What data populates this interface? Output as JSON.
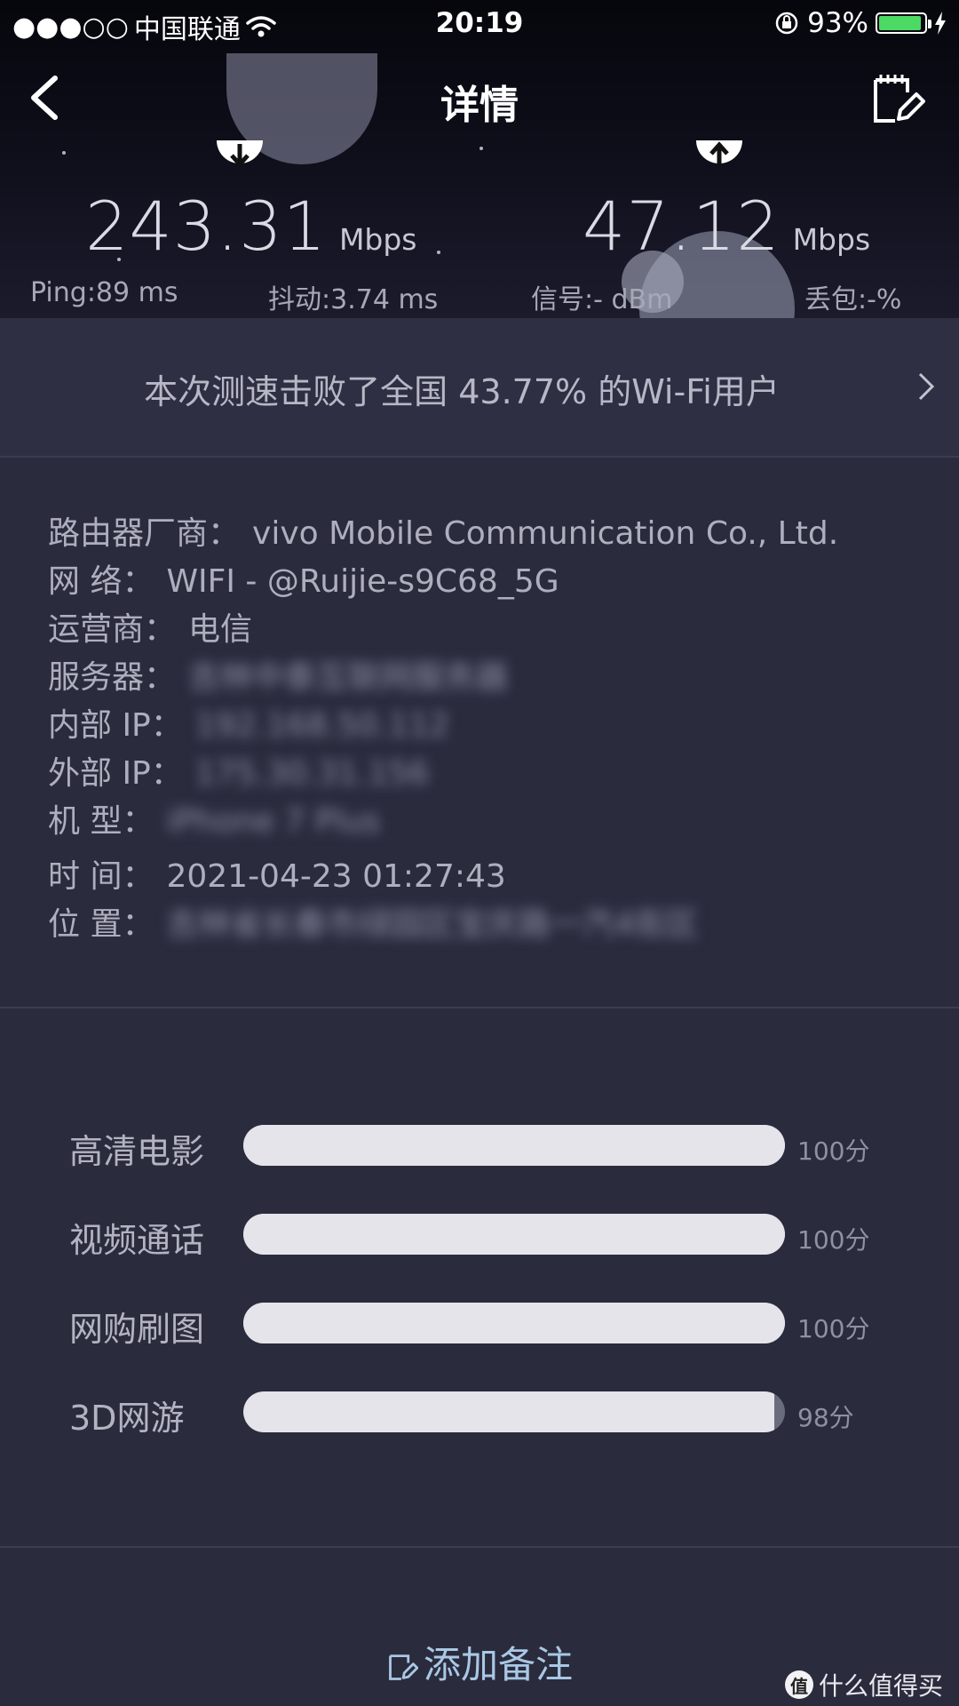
{
  "status_bar": {
    "signal": "●●●○○",
    "carrier": "中国联通",
    "time": "20:19",
    "battery": "93%",
    "battery_level": 0.93
  },
  "nav": {
    "title": "详情"
  },
  "speeds": {
    "download": {
      "value": "243.31",
      "unit": "Mbps"
    },
    "upload": {
      "value": "47.12",
      "unit": "Mbps"
    }
  },
  "metrics": {
    "ping": "Ping:89 ms",
    "jitter": "抖动:3.74 ms",
    "signal": "信号:- dBm",
    "loss": "丢包:-%"
  },
  "rank": {
    "text": "本次测速击败了全国 43.77% 的Wi-Fi用户"
  },
  "info": {
    "vendor_label": "路由器厂商：",
    "vendor": "vivo Mobile Communication Co., Ltd.",
    "network_label": "网 络：",
    "network": "WIFI - @Ruijie-s9C68_5G",
    "carrier_label": "运营商：",
    "carrier": "电信",
    "server_label": "服务器：",
    "server": "吉林中泰互联网服务器",
    "internal_ip_label": "内部 IP：",
    "internal_ip": "192.168.50.112",
    "external_ip_label": "外部 IP：",
    "external_ip": "175.30.31.156",
    "model_label": "机 型：",
    "model": "iPhone 7 Plus",
    "time_label": "时 间：",
    "time": "2021-04-23 01:27:43",
    "location_label": "位 置：",
    "location": "吉林省长春市绿园区宝庆路一汽4街区"
  },
  "scores": [
    {
      "label": "高清电影",
      "value": "100分",
      "level": 1.0
    },
    {
      "label": "视频通话",
      "value": "100分",
      "level": 1.0
    },
    {
      "label": "网购刷图",
      "value": "100分",
      "level": 1.0
    },
    {
      "label": "3D网游",
      "value": "98分",
      "level": 0.98
    }
  ],
  "footer": {
    "add_note": "添加备注"
  },
  "watermark": {
    "badge": "值",
    "text": "什么值得买"
  },
  "colors": {
    "background": "#2b2b3e",
    "battery": "#4cd964",
    "note_link": "#a9c8e4"
  }
}
